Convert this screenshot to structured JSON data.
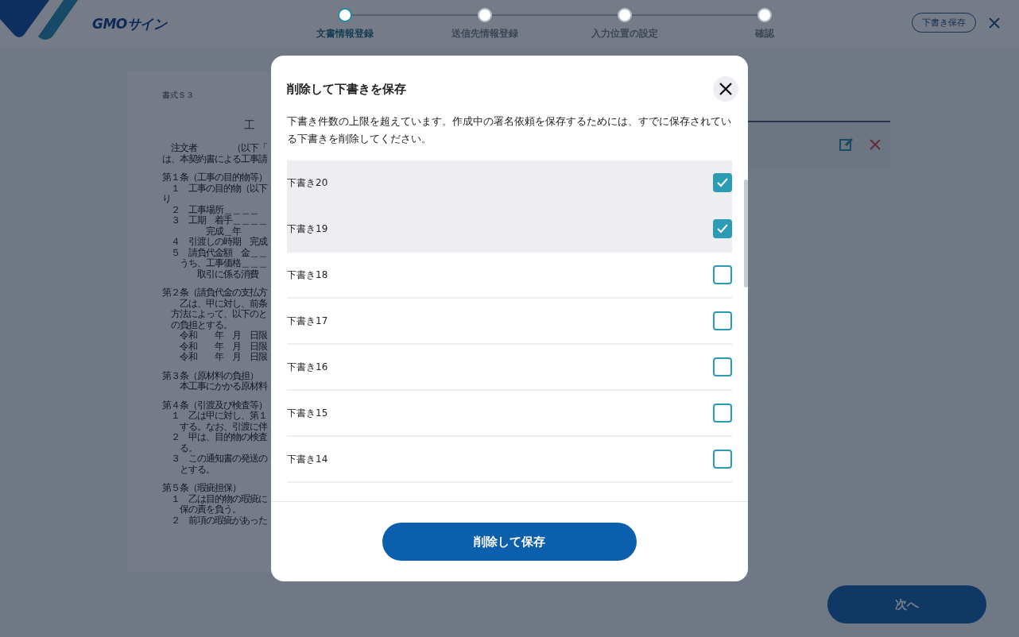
{
  "header": {
    "logo": "GMOサイン",
    "steps": [
      {
        "label": "文書情報登録",
        "selected": true
      },
      {
        "label": "送信先情報登録",
        "selected": false
      },
      {
        "label": "入力位置の設定",
        "selected": false
      },
      {
        "label": "確認",
        "selected": false
      }
    ],
    "save_draft_button": "下書き保存"
  },
  "document_preview": {
    "blocks": [
      {
        "kind": "note",
        "lines": [
          "書式Ｓ３"
        ]
      },
      {
        "kind": "title",
        "lines": [
          "工"
        ]
      },
      {
        "kind": "body",
        "lines": [
          "　注文者　　　　（以下「",
          "は、本契約書による工事請"
        ]
      },
      {
        "kind": "body",
        "lines": [
          "第１条（工事の目的物等）",
          "　１　工事の目的物（以下",
          "り",
          "　２　工事場所＿＿＿＿",
          "　３　工期　着手＿＿＿＿",
          "　　　　　完成＿年",
          "　４　引渡しの時期　完成",
          "　５　請負代金額　金＿＿",
          "　　うち、工事価格＿＿＿",
          "　　　　取引に係る消費"
        ]
      },
      {
        "kind": "body",
        "lines": [
          "第２条（請負代金の支払方",
          "　　乙は、甲に対し、前条",
          "　方法によって、以下のと",
          "　の負担とする。",
          "　　令和　　年　月　日限",
          "　　令和　　年　月　日限",
          "　　令和　　年　月　日限"
        ]
      },
      {
        "kind": "body",
        "lines": [
          "第３条（原材料の負担）",
          "　　本工事にかかる原材料"
        ]
      },
      {
        "kind": "body",
        "lines": [
          "第４条（引渡及び検査等）",
          "　１　乙は甲に対し、第１",
          "　　する。なお、引渡に伴",
          "　２　甲は、目的物の検査",
          "　　る。",
          "　３　この通知書の発送の",
          "　　とする。"
        ]
      },
      {
        "kind": "body",
        "lines": [
          "第５条（瑕疵担保）",
          "　１　乙は目的物の瑕疵に",
          "　　保の責を負う。",
          "　２　前項の瑕疵があった"
        ]
      }
    ]
  },
  "next_button": "次へ",
  "dialog": {
    "title": "削除して下書きを保存",
    "message": "下書き件数の上限を超えています。作成中の署名依頼を保存するためには、すでに保存されている下書きを削除してください。",
    "drafts": [
      {
        "name": "下書き20",
        "checked": true
      },
      {
        "name": "下書き19",
        "checked": true
      },
      {
        "name": "下書き18",
        "checked": false
      },
      {
        "name": "下書き17",
        "checked": false
      },
      {
        "name": "下書き16",
        "checked": false
      },
      {
        "name": "下書き15",
        "checked": false
      },
      {
        "name": "下書き14",
        "checked": false
      }
    ],
    "submit_button": "削除して保存"
  }
}
